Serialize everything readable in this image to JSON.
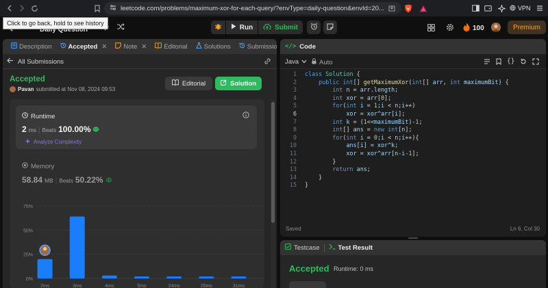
{
  "browser": {
    "url": "leetcode.com/problems/maximum-xor-for-each-query/?envType=daily-question&envId=20...",
    "tooltip": "Click to go back, hold to see history",
    "vpn_label": "VPN"
  },
  "topbar": {
    "daily_label": "Daily Question",
    "run_label": "Run",
    "submit_label": "Submit",
    "coins": "100",
    "premium_label": "Premium"
  },
  "left_tabs": [
    {
      "label": "Description"
    },
    {
      "label": "Accepted"
    },
    {
      "label": "Note"
    },
    {
      "label": "Editorial"
    },
    {
      "label": "Solutions"
    },
    {
      "label": "Submissions"
    }
  ],
  "submission": {
    "back_label": "All Submissions",
    "status": "Accepted",
    "user": "Pavan",
    "submitted_text": "submitted at Nov 08, 2024 09:53",
    "editorial_btn": "Editorial",
    "solution_btn": "Solution"
  },
  "runtime": {
    "title": "Runtime",
    "value": "2",
    "unit": "ms",
    "beats_label": "Beats",
    "beats": "100.00%",
    "analyze_label": "Analyze Complexity"
  },
  "memory": {
    "title": "Memory",
    "value": "58.84",
    "unit": "MB",
    "beats_label": "Beats",
    "beats": "50.22%"
  },
  "chart_data": {
    "type": "bar",
    "categories": [
      "2ms",
      "3ms",
      "4ms",
      "5ms",
      "24ms",
      "25ms",
      "31ms"
    ],
    "values": [
      20,
      64,
      3,
      2,
      2,
      2,
      2
    ],
    "ylim": [
      0,
      75
    ],
    "yticks": [
      "75%",
      "50%",
      "25%",
      "0%"
    ],
    "highlight_index": 0,
    "bar_color": "#1a7dfa",
    "grid": true
  },
  "code": {
    "title": "Code",
    "language": "Java",
    "auto_label": "Auto",
    "status": "Saved",
    "cursor": "Ln 6, Col 30",
    "lines": [
      "class Solution {",
      "    public int[] getMaximumXor(int[] arr, int maximumBit) {",
      "        int n = arr.length;",
      "        int xor = arr[0];",
      "        for(int i = 1;i < n;i++)",
      "            xor = xor^arr[i];",
      "        int k = (1<<maximumBit)-1;",
      "        int[] ans = new int[n];",
      "        for(int i = 0;i < n;i++){",
      "            ans[i] = xor^k;",
      "            xor = xor^arr[n-i-1];",
      "        }",
      "        return ans;",
      "    }",
      "}"
    ]
  },
  "test": {
    "testcase_label": "Testcase",
    "result_label": "Test Result",
    "status": "Accepted",
    "runtime": "Runtime: 0 ms"
  }
}
